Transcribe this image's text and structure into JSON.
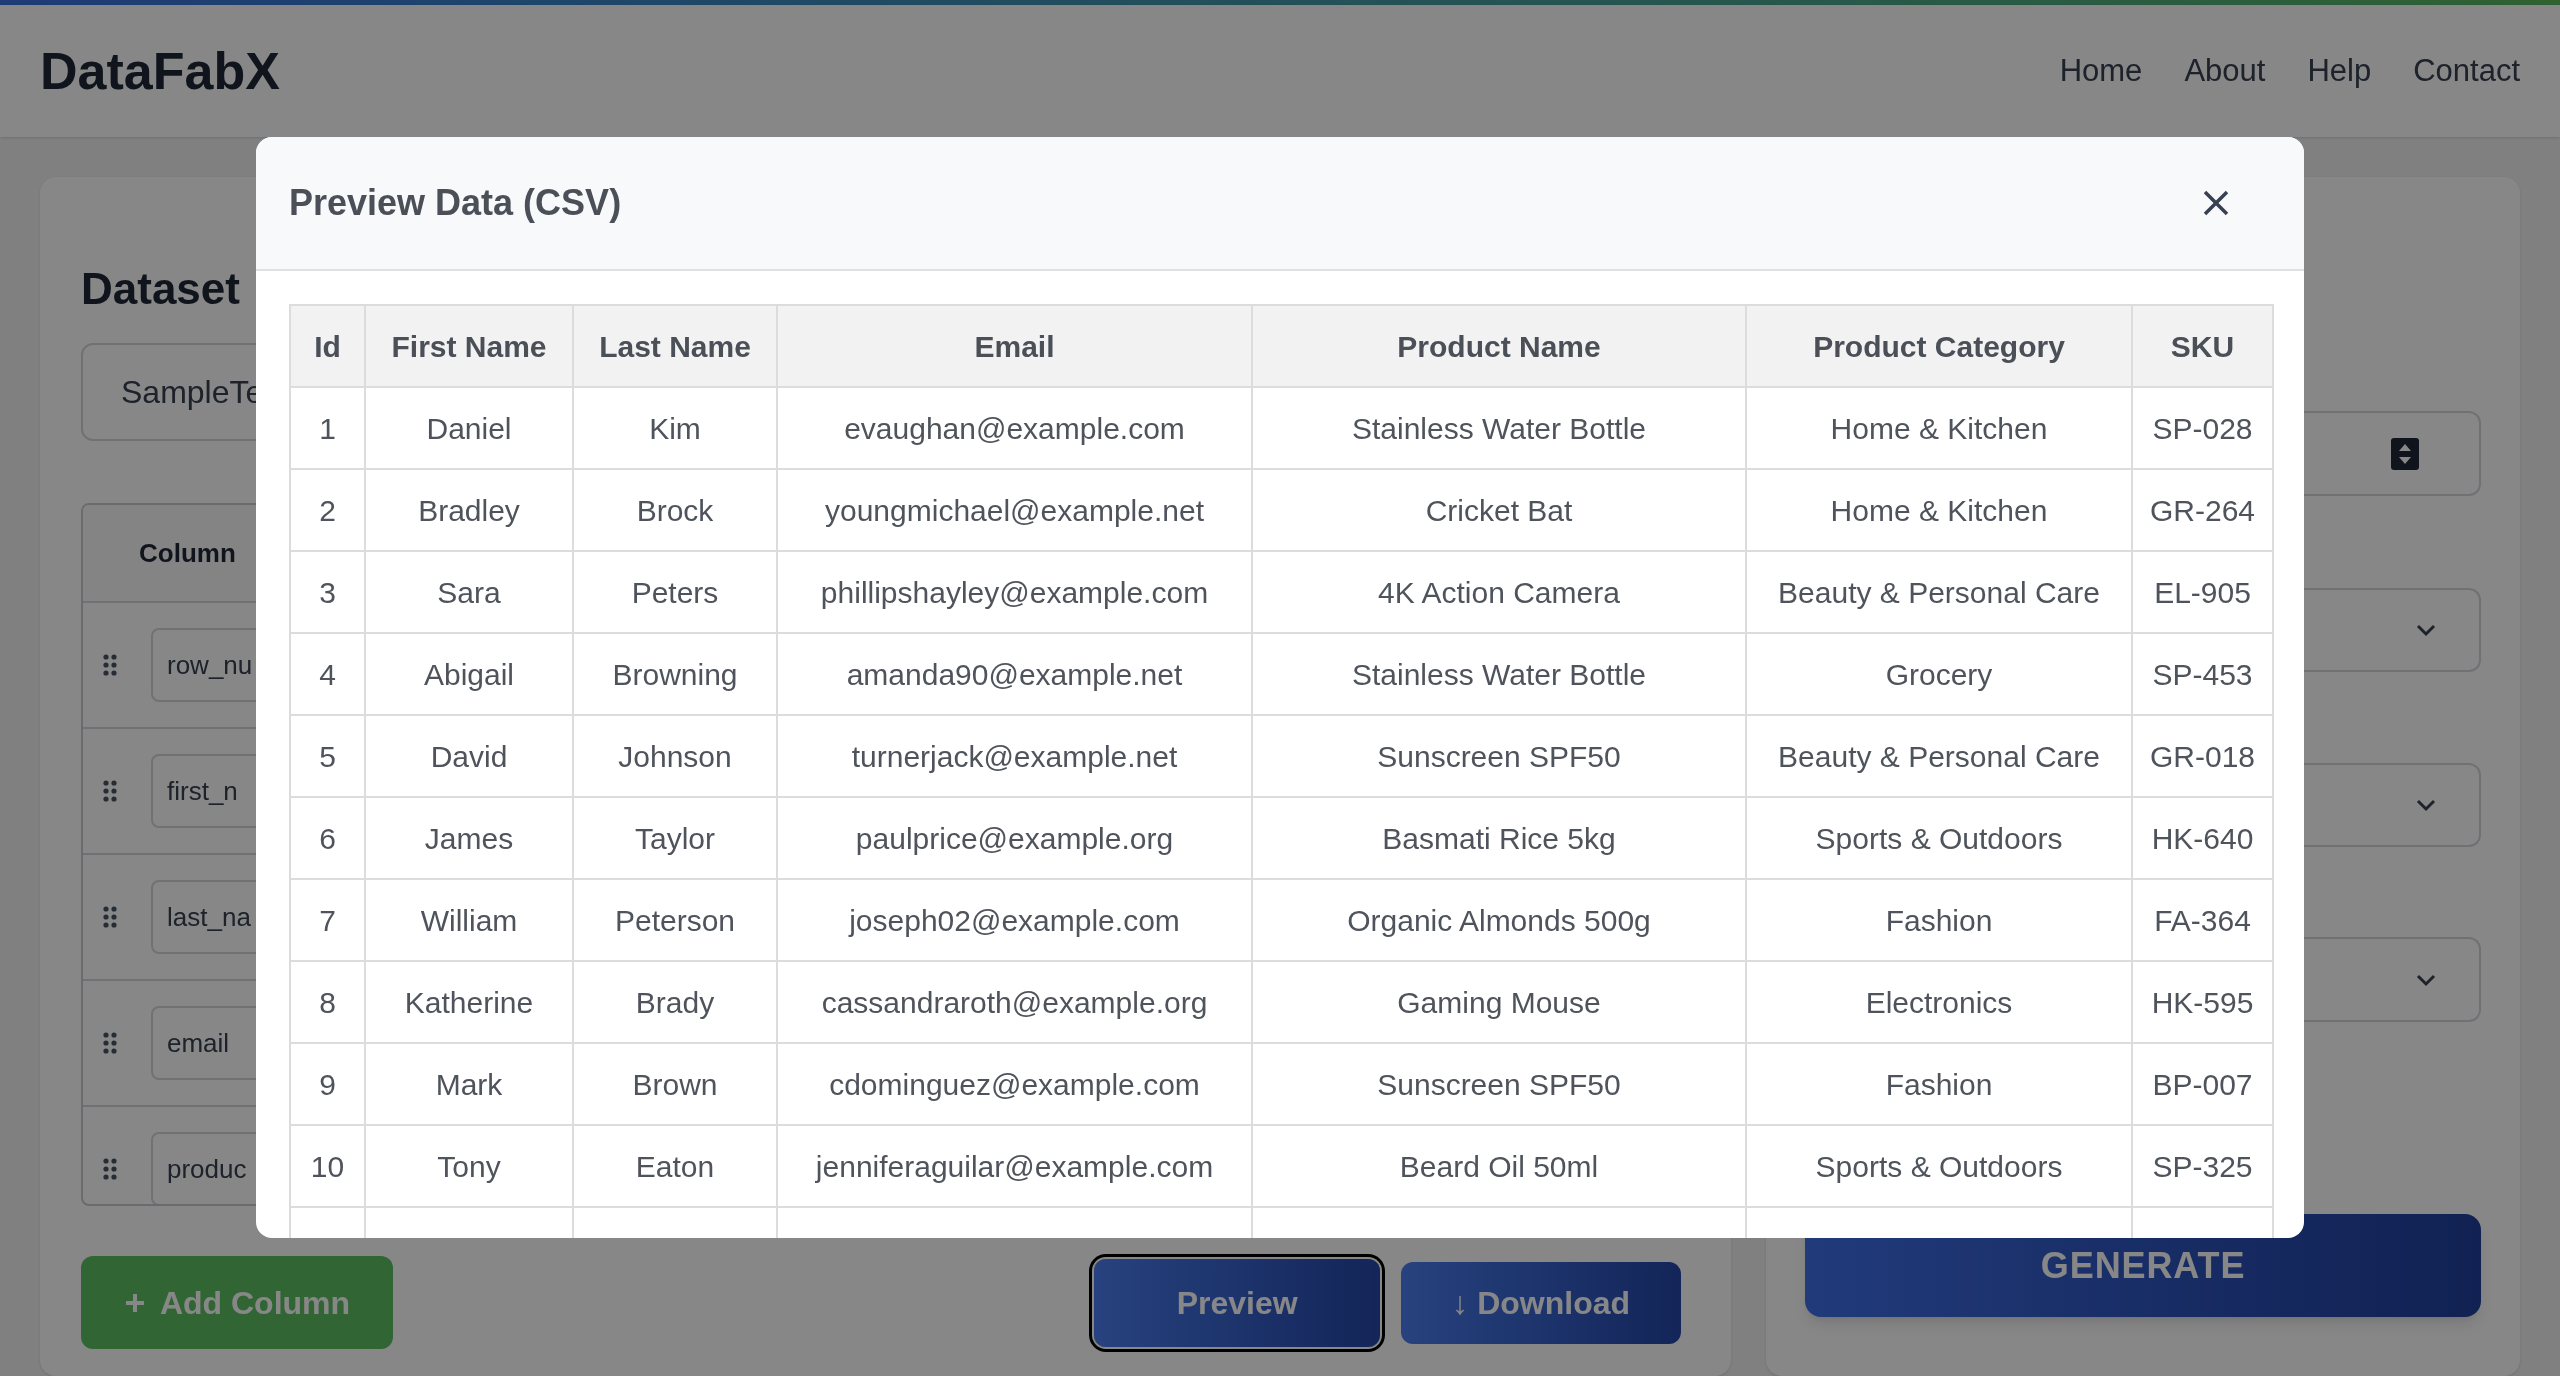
{
  "header": {
    "logo": "DataFabX",
    "nav": [
      "Home",
      "About",
      "Help",
      "Contact"
    ]
  },
  "config_panel": {
    "heading": "Dataset",
    "name_field_value": "SampleTe",
    "columns_table": {
      "heading": "Column",
      "rows": [
        "row_nu",
        "first_n",
        "last_na",
        "email",
        "produc"
      ]
    },
    "add_button": "Add Column",
    "preview_button": "Preview",
    "download_button": "↓ Download"
  },
  "settings_panel": {
    "generate_button": "GENERATE"
  },
  "modal": {
    "title": "Preview Data (CSV)",
    "table": {
      "columns": [
        "Id",
        "First Name",
        "Last Name",
        "Email",
        "Product Name",
        "Product Category",
        "SKU"
      ],
      "rows": [
        [
          "1",
          "Daniel",
          "Kim",
          "evaughan@example.com",
          "Stainless Water Bottle",
          "Home & Kitchen",
          "SP-028"
        ],
        [
          "2",
          "Bradley",
          "Brock",
          "youngmichael@example.net",
          "Cricket Bat",
          "Home & Kitchen",
          "GR-264"
        ],
        [
          "3",
          "Sara",
          "Peters",
          "phillipshayley@example.com",
          "4K Action Camera",
          "Beauty & Personal Care",
          "EL-905"
        ],
        [
          "4",
          "Abigail",
          "Browning",
          "amanda90@example.net",
          "Stainless Water Bottle",
          "Grocery",
          "SP-453"
        ],
        [
          "5",
          "David",
          "Johnson",
          "turnerjack@example.net",
          "Sunscreen SPF50",
          "Beauty & Personal Care",
          "GR-018"
        ],
        [
          "6",
          "James",
          "Taylor",
          "paulprice@example.org",
          "Basmati Rice 5kg",
          "Sports & Outdoors",
          "HK-640"
        ],
        [
          "7",
          "William",
          "Peterson",
          "joseph02@example.com",
          "Organic Almonds 500g",
          "Fashion",
          "FA-364"
        ],
        [
          "8",
          "Katherine",
          "Brady",
          "cassandraroth@example.org",
          "Gaming Mouse",
          "Electronics",
          "HK-595"
        ],
        [
          "9",
          "Mark",
          "Brown",
          "cdominguez@example.com",
          "Sunscreen SPF50",
          "Fashion",
          "BP-007"
        ],
        [
          "10",
          "Tony",
          "Eaton",
          "jenniferaguilar@example.com",
          "Beard Oil 50ml",
          "Sports & Outdoors",
          "SP-325"
        ]
      ]
    }
  }
}
